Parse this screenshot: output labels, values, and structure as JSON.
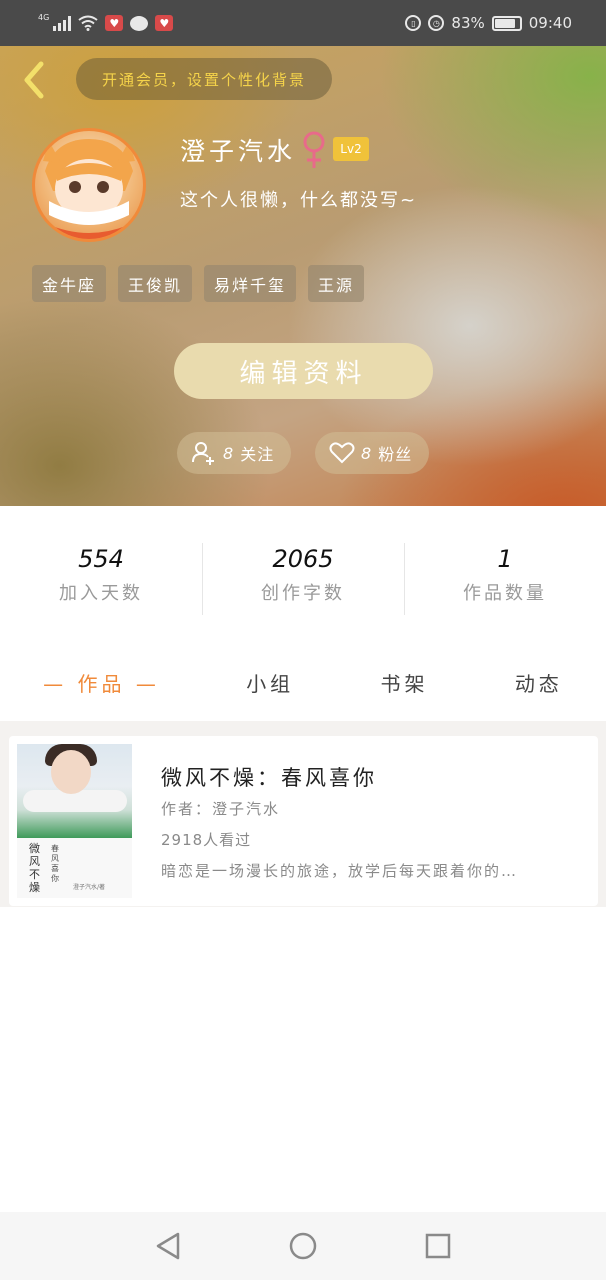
{
  "status_bar": {
    "network": "4G",
    "battery_percent": "83%",
    "battery_level": 0.83,
    "time": "09:40"
  },
  "header": {
    "vip_banner": "开通会员，设置个性化背景",
    "username": "澄子汽水",
    "gender": "female",
    "level": "Lv2",
    "bio": "这个人很懒，什么都没写~",
    "tags": [
      "金牛座",
      "王俊凯",
      "易烊千玺",
      "王源"
    ],
    "edit_button": "编辑资料",
    "follow": {
      "count": "8",
      "label": "关注"
    },
    "fans": {
      "count": "8",
      "label": "粉丝"
    }
  },
  "stats": [
    {
      "value": "554",
      "label": "加入天数"
    },
    {
      "value": "2065",
      "label": "创作字数"
    },
    {
      "value": "1",
      "label": "作品数量"
    }
  ],
  "tabs": {
    "works": "— 作品 —",
    "group": "小组",
    "bookshelf": "书架",
    "activity": "动态"
  },
  "work": {
    "title": "微风不燥：春风喜你",
    "author": "作者：澄子汽水",
    "views": "2918人看过",
    "description": "暗恋是一场漫长的旅途，放学后每天跟着你的…",
    "cover_title": "微风不燥",
    "cover_subtitle": "春风喜你",
    "cover_author": "澄子汽水/著"
  },
  "colors": {
    "accent": "#f08a3a",
    "vip_text": "#f5d34a",
    "level_badge": "#f0c23a",
    "gender": "#e86a8a",
    "edit_button": "#e9dbae"
  },
  "icons": {
    "back": "chevron-left-icon",
    "gender": "female-icon",
    "follow": "add-user-icon",
    "fans": "heart-icon",
    "nav_back": "triangle-back-icon",
    "nav_home": "circle-home-icon",
    "nav_recent": "square-recent-icon"
  }
}
